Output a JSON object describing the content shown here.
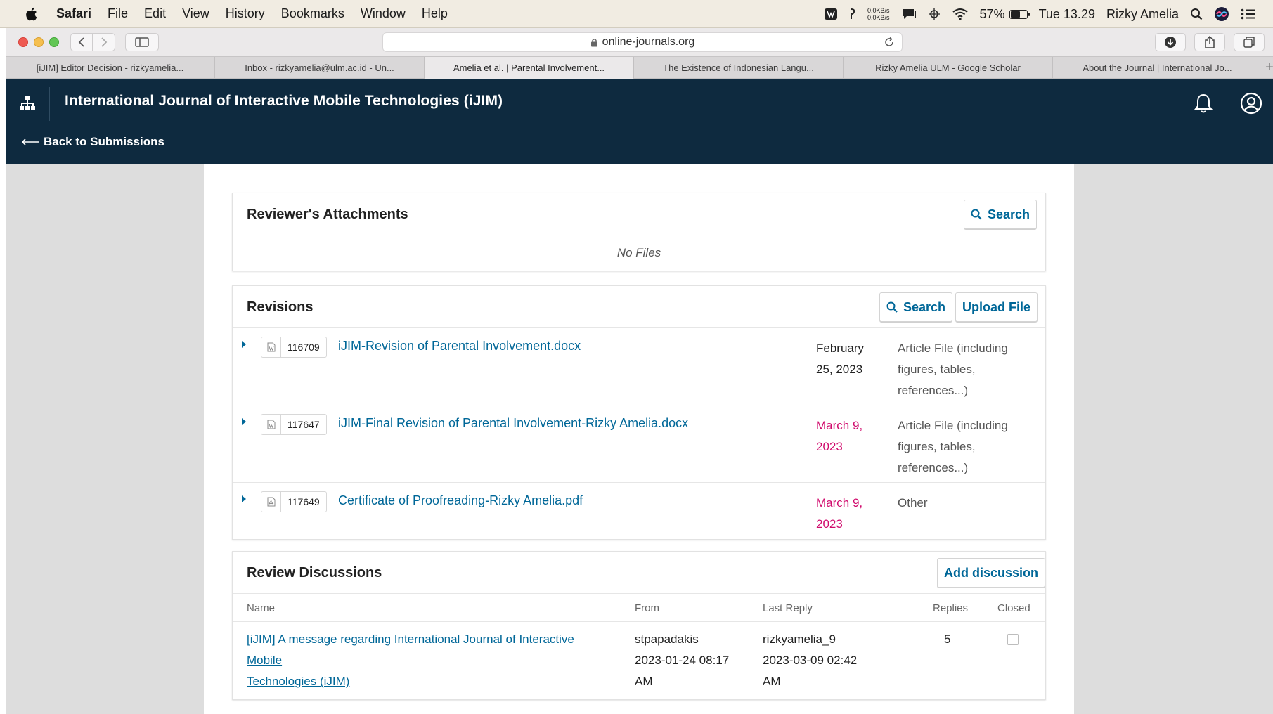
{
  "menubar": {
    "app_name": "Safari",
    "items": [
      "File",
      "Edit",
      "View",
      "History",
      "Bookmarks",
      "Window",
      "Help"
    ],
    "net_up": "0.0KB/s",
    "net_down": "0.0KB/s",
    "battery": "57%",
    "clock": "Tue 13.29",
    "user": "Rizky Amelia"
  },
  "browser": {
    "url": "online-journals.org",
    "tabs": [
      "[iJIM] Editor Decision - rizkyamelia...",
      "Inbox - rizkyamelia@ulm.ac.id - Un...",
      "Amelia et al. | Parental Involvement...",
      "The Existence of Indonesian Langu...",
      "Rizky Amelia ULM - Google Scholar",
      "About the Journal | International Jo..."
    ],
    "active_tab": 2,
    "new_tab": "+"
  },
  "header": {
    "journal_title": "International Journal of Interactive Mobile Technologies (iJIM)",
    "back_link": "Back to Submissions"
  },
  "reviewer_attachments": {
    "title": "Reviewer's Attachments",
    "search_label": "Search",
    "empty_text": "No Files"
  },
  "revisions": {
    "title": "Revisions",
    "search_label": "Search",
    "upload_label": "Upload File",
    "files": [
      {
        "id": "116709",
        "name": "iJIM-Revision of Parental Involvement.docx",
        "date_line1": "February",
        "date_line2": "25, 2023",
        "type_line1": "Article File (including",
        "type_line2": "figures, tables,",
        "type_line3": "references...)",
        "new": false,
        "kind": "doc"
      },
      {
        "id": "117647",
        "name": "iJIM-Final Revision of Parental Involvement-Rizky Amelia.docx",
        "date_line1": "March 9,",
        "date_line2": "2023",
        "type_line1": "Article File (including",
        "type_line2": "figures, tables,",
        "type_line3": "references...)",
        "new": true,
        "kind": "doc"
      },
      {
        "id": "117649",
        "name": "Certificate of Proofreading-Rizky Amelia.pdf",
        "date_line1": "March 9,",
        "date_line2": "2023",
        "type_line1": "Other",
        "type_line2": "",
        "type_line3": "",
        "new": true,
        "kind": "pdf"
      }
    ]
  },
  "review_discussions": {
    "title": "Review Discussions",
    "add_label": "Add discussion",
    "columns": {
      "name": "Name",
      "from": "From",
      "last_reply": "Last Reply",
      "replies": "Replies",
      "closed": "Closed"
    },
    "rows": [
      {
        "name_line1": "[iJIM] A message regarding International Journal of Interactive Mobile",
        "name_line2": "Technologies (iJIM)",
        "from_user": "stpapadakis",
        "from_date": "2023-01-24 08:17",
        "from_ampm": "AM",
        "last_user": "rizkyamelia_9",
        "last_date": "2023-03-09 02:42",
        "last_ampm": "AM",
        "replies": "5",
        "closed": false
      }
    ]
  },
  "colors": {
    "header_bg": "#0e2a3f",
    "link": "#006798",
    "new_date": "#d00a6c"
  }
}
